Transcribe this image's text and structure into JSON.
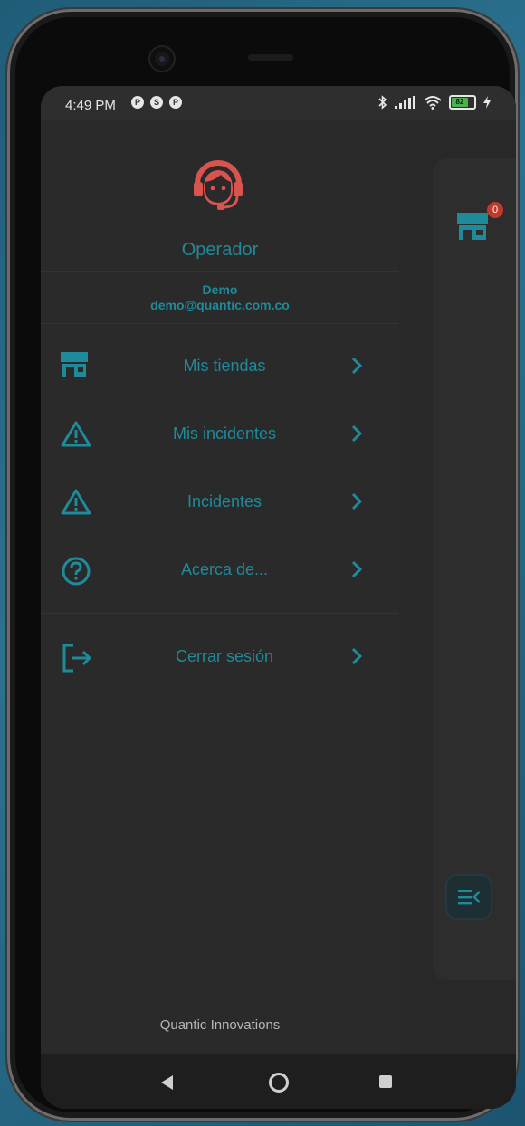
{
  "status_bar": {
    "time": "4:49 PM",
    "notifications": [
      "P",
      "S",
      "P"
    ],
    "battery_level": "82"
  },
  "drawer": {
    "role": "Operador",
    "user": {
      "name": "Demo",
      "email": "demo@quantic.com.co"
    },
    "items": [
      {
        "label": "Mis tiendas",
        "icon": "store-icon"
      },
      {
        "label": "Mis incidentes",
        "icon": "warning-icon"
      },
      {
        "label": "Incidentes",
        "icon": "warning-icon"
      },
      {
        "label": "Acerca de...",
        "icon": "help-circle-icon"
      }
    ],
    "logout": {
      "label": "Cerrar sesión",
      "icon": "logout-icon"
    },
    "footer": "Quantic Innovations"
  },
  "side_panel": {
    "store_badge_count": "0"
  },
  "colors": {
    "accent": "#1f8a99",
    "operator_icon": "#d9534f",
    "badge": "#c0392b",
    "background": "#282828"
  }
}
